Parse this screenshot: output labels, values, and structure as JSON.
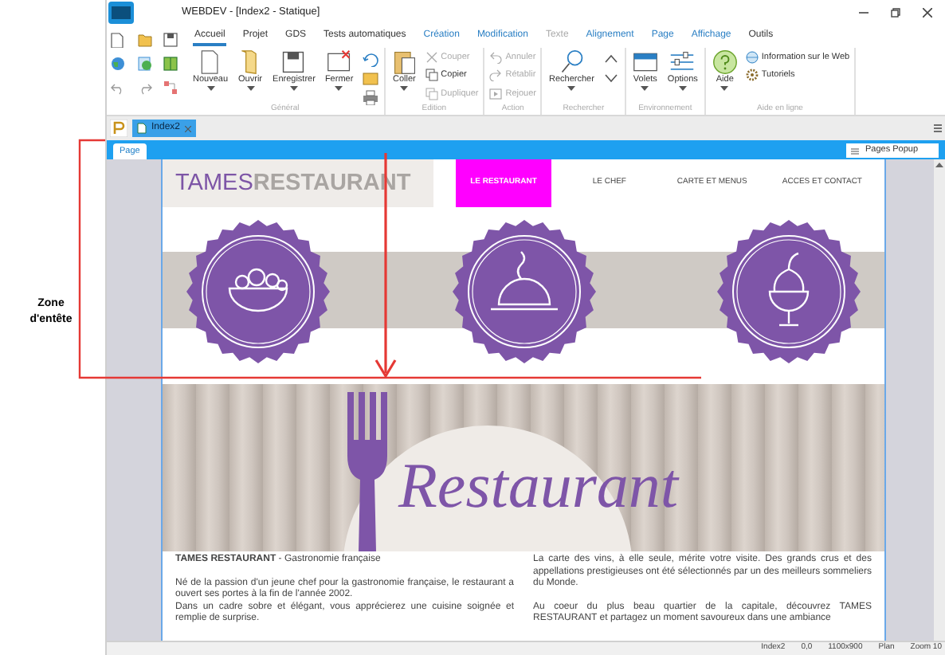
{
  "window": {
    "title": "WEBDEV - [Index2 - Statique]"
  },
  "annotation": {
    "label": "Zone d'entête"
  },
  "ribbon_tabs": [
    {
      "label": "Accueil",
      "selected": true,
      "kind": "standard"
    },
    {
      "label": "Projet",
      "selected": false,
      "kind": "standard"
    },
    {
      "label": "GDS",
      "selected": false,
      "kind": "standard"
    },
    {
      "label": "Tests automatiques",
      "selected": false,
      "kind": "standard"
    },
    {
      "label": "Création",
      "selected": false,
      "kind": "contextual"
    },
    {
      "label": "Modification",
      "selected": false,
      "kind": "contextual"
    },
    {
      "label": "Texte",
      "selected": false,
      "kind": "inactive"
    },
    {
      "label": "Alignement",
      "selected": false,
      "kind": "contextual"
    },
    {
      "label": "Page",
      "selected": false,
      "kind": "contextual"
    },
    {
      "label": "Affichage",
      "selected": false,
      "kind": "contextual"
    },
    {
      "label": "Outils",
      "selected": false,
      "kind": "standard"
    }
  ],
  "ribbon_groups": [
    {
      "title": "Général",
      "items": [
        {
          "kind": "large",
          "label": "Nouveau"
        },
        {
          "kind": "large",
          "label": "Ouvrir"
        },
        {
          "kind": "large",
          "label": "Enregistrer"
        },
        {
          "kind": "large",
          "label": "Fermer"
        },
        {
          "kind": "icon"
        },
        {
          "kind": "icon"
        },
        {
          "kind": "icon"
        }
      ]
    },
    {
      "title": "Edition",
      "items": [
        {
          "kind": "large",
          "label": "Coller"
        },
        {
          "kind": "small",
          "label": "Couper",
          "disabled": true
        },
        {
          "kind": "small",
          "label": "Copier",
          "disabled": false
        },
        {
          "kind": "small",
          "label": "Dupliquer",
          "disabled": true
        }
      ]
    },
    {
      "title": "Action",
      "items": [
        {
          "kind": "small",
          "label": "Annuler",
          "disabled": true
        },
        {
          "kind": "small",
          "label": "Rétablir",
          "disabled": true
        },
        {
          "kind": "small",
          "label": "Rejouer",
          "disabled": true
        }
      ]
    },
    {
      "title": "Rechercher",
      "items": [
        {
          "kind": "large",
          "label": "Rechercher"
        },
        {
          "kind": "icon"
        },
        {
          "kind": "icon"
        }
      ]
    },
    {
      "title": "Environnement",
      "items": [
        {
          "kind": "large",
          "label": "Volets"
        },
        {
          "kind": "large",
          "label": "Options"
        }
      ]
    },
    {
      "title": "Aide en ligne",
      "items": [
        {
          "kind": "large",
          "label": "Aide"
        },
        {
          "kind": "small",
          "label": "Information sur le Web",
          "disabled": false
        },
        {
          "kind": "small",
          "label": "Tutoriels",
          "disabled": false
        }
      ]
    }
  ],
  "document_tabs": [
    {
      "label": "Index2",
      "selected": true
    }
  ],
  "page_tab": {
    "label": "Page"
  },
  "popup_button": {
    "label": "Pages Popup"
  },
  "site": {
    "logo": {
      "part1": "TAMES",
      "part2": "RESTAURANT"
    },
    "nav": [
      {
        "label": "LE RESTAURANT",
        "selected": true
      },
      {
        "label": "LE CHEF",
        "selected": false
      },
      {
        "label": "CARTE ET MENUS",
        "selected": false
      },
      {
        "label": "ACCES ET CONTACT",
        "selected": false
      }
    ],
    "hero_title": "Restaurant",
    "columns": [
      [
        "**TAMES RESTAURANT** - Gastronomie française",
        "Né de la passion d'un jeune chef pour la gastronomie française, le restaurant a ouvert ses portes à la fin de l'année 2002.\nDans un cadre sobre et élégant, vous apprécierez une cuisine soignée et remplie de surprise."
      ],
      [
        "La carte des vins, à elle seule, mérite votre visite. Des grands crus et des appellations prestigieuses ont été sélectionnés par un des meilleurs sommeliers du Monde.",
        "Au coeur du plus beau quartier de la capitale, découvrez TAMES RESTAURANT et partagez un moment savoureux dans une ambiance"
      ]
    ]
  },
  "status_bar": [
    "Index2",
    "0,0",
    "1100x900",
    "Plan",
    "Zoom 10"
  ]
}
